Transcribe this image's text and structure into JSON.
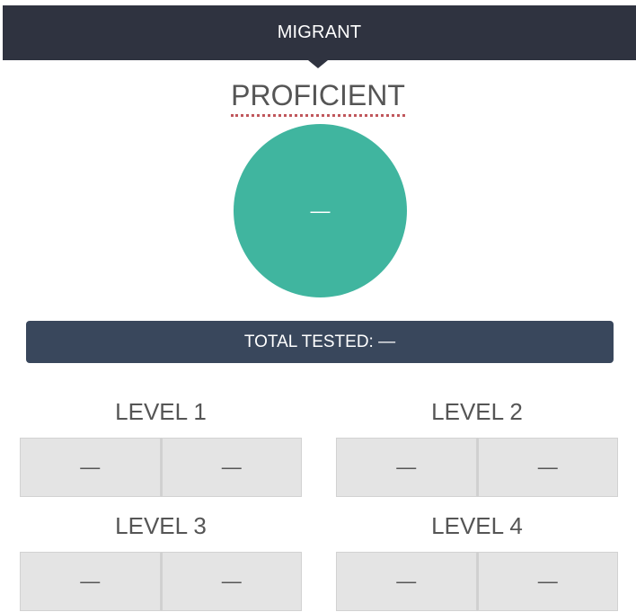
{
  "header": {
    "title": "MIGRANT"
  },
  "proficient": {
    "title": "PROFICIENT",
    "value": "—"
  },
  "total_tested": {
    "label": "TOTAL TESTED: —"
  },
  "levels": [
    {
      "label": "LEVEL 1",
      "values": [
        "—",
        "—"
      ]
    },
    {
      "label": "LEVEL 2",
      "values": [
        "—",
        "—"
      ]
    },
    {
      "label": "LEVEL 3",
      "values": [
        "—",
        "—"
      ]
    },
    {
      "label": "LEVEL 4",
      "values": [
        "—",
        "—"
      ]
    }
  ],
  "colors": {
    "header_bg": "#2f3340",
    "circle": "#40b59f",
    "total_bar": "#39475c",
    "underline_dots": "#c0575c",
    "cell_bg": "#e4e4e4"
  }
}
